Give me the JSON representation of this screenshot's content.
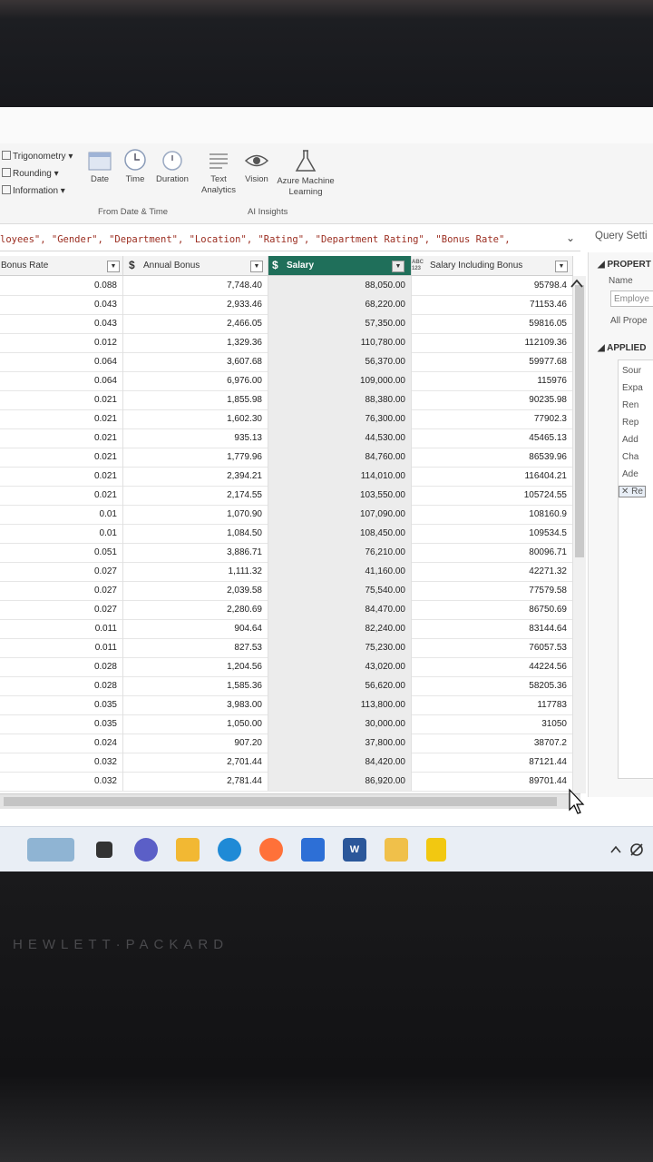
{
  "ribbon": {
    "dropdowns": [
      "Trigonometry",
      "Rounding",
      "Information"
    ],
    "buttons": [
      "Date",
      "Time",
      "Duration",
      "Text Analytics",
      "Vision",
      "Azure Machine Learning"
    ],
    "groups": [
      "From Date & Time",
      "AI Insights"
    ]
  },
  "formula_bar": {
    "text": "loyees\", \"Gender\", \"Department\", \"Location\", \"Rating\", \"Department Rating\", \"Bonus Rate\","
  },
  "query_settings": {
    "title": "Query Setti",
    "properties_header": "PROPERT",
    "name_label": "Name",
    "name_value": "Employe",
    "all_properties": "All Prope",
    "applied_header": "APPLIED",
    "steps": [
      "Sour",
      "Expa",
      "Ren",
      "Rep",
      "Add",
      "Cha",
      "Ade",
      "Re"
    ]
  },
  "table": {
    "columns": [
      {
        "type": "",
        "label": "Bonus Rate"
      },
      {
        "type": "$",
        "label": "Annual Bonus"
      },
      {
        "type": "$",
        "label": "Salary"
      },
      {
        "type": "ABC 123",
        "label": "Salary Including Bonus"
      }
    ],
    "rows": [
      [
        "0.088",
        "7,748.40",
        "88,050.00",
        "95798.4"
      ],
      [
        "0.043",
        "2,933.46",
        "68,220.00",
        "71153.46"
      ],
      [
        "0.043",
        "2,466.05",
        "57,350.00",
        "59816.05"
      ],
      [
        "0.012",
        "1,329.36",
        "110,780.00",
        "112109.36"
      ],
      [
        "0.064",
        "3,607.68",
        "56,370.00",
        "59977.68"
      ],
      [
        "0.064",
        "6,976.00",
        "109,000.00",
        "115976"
      ],
      [
        "0.021",
        "1,855.98",
        "88,380.00",
        "90235.98"
      ],
      [
        "0.021",
        "1,602.30",
        "76,300.00",
        "77902.3"
      ],
      [
        "0.021",
        "935.13",
        "44,530.00",
        "45465.13"
      ],
      [
        "0.021",
        "1,779.96",
        "84,760.00",
        "86539.96"
      ],
      [
        "0.021",
        "2,394.21",
        "114,010.00",
        "116404.21"
      ],
      [
        "0.021",
        "2,174.55",
        "103,550.00",
        "105724.55"
      ],
      [
        "0.01",
        "1,070.90",
        "107,090.00",
        "108160.9"
      ],
      [
        "0.01",
        "1,084.50",
        "108,450.00",
        "109534.5"
      ],
      [
        "0.051",
        "3,886.71",
        "76,210.00",
        "80096.71"
      ],
      [
        "0.027",
        "1,111.32",
        "41,160.00",
        "42271.32"
      ],
      [
        "0.027",
        "2,039.58",
        "75,540.00",
        "77579.58"
      ],
      [
        "0.027",
        "2,280.69",
        "84,470.00",
        "86750.69"
      ],
      [
        "0.011",
        "904.64",
        "82,240.00",
        "83144.64"
      ],
      [
        "0.011",
        "827.53",
        "75,230.00",
        "76057.53"
      ],
      [
        "0.028",
        "1,204.56",
        "43,020.00",
        "44224.56"
      ],
      [
        "0.028",
        "1,585.36",
        "56,620.00",
        "58205.36"
      ],
      [
        "0.035",
        "3,983.00",
        "113,800.00",
        "117783"
      ],
      [
        "0.035",
        "1,050.00",
        "30,000.00",
        "31050"
      ],
      [
        "0.024",
        "907.20",
        "37,800.00",
        "38707.2"
      ],
      [
        "0.032",
        "2,701.44",
        "84,420.00",
        "87121.44"
      ],
      [
        "0.032",
        "2,781.44",
        "86,920.00",
        "89701.44"
      ]
    ]
  },
  "taskbar": {
    "apps": [
      "widgets",
      "file-explorer",
      "teams-chat",
      "folder",
      "edge",
      "firefox",
      "store",
      "word",
      "snipping-tool",
      "power-bi"
    ],
    "word_letter": "W"
  },
  "bezel": {
    "brand": "HEWLETT·PACKARD"
  },
  "colors": {
    "active_header": "#1f6f5a",
    "formula_text": "#9b2d20"
  }
}
